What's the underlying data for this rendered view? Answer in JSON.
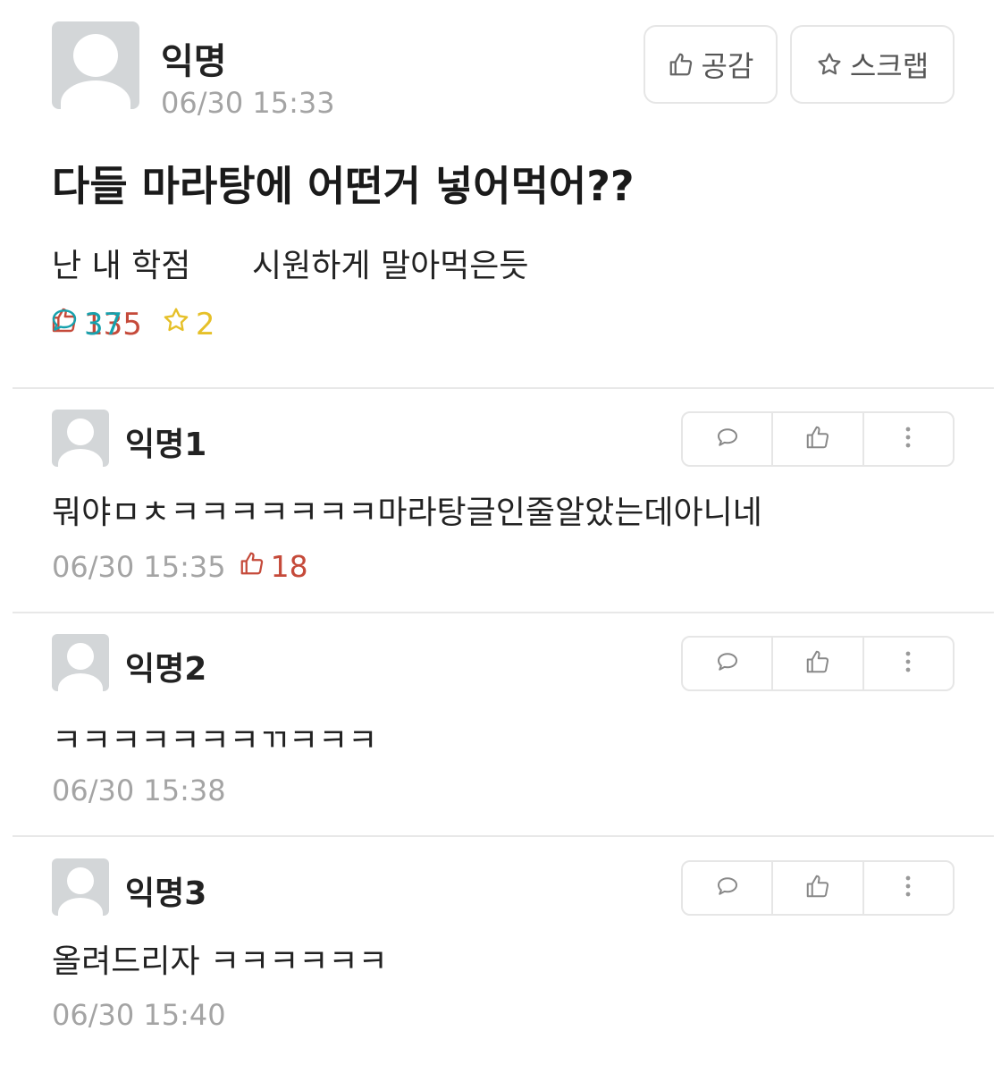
{
  "post": {
    "author": "익명",
    "time": "06/30 15:33",
    "empathy_label": "공감",
    "scrap_label": "스크랩",
    "title": "다들 마라탕에 어떤거 넣어먹어??",
    "body": "난 내 학점      시원하게 말아먹은듯",
    "likes": "135",
    "comments": "37",
    "scraps": "2"
  },
  "comments": [
    {
      "author": "익명1",
      "text": "뭐야ㅁㅊㅋㅋㅋㅋㅋㅋㅋ마라탕글인줄알았는데아니네",
      "time": "06/30 15:35",
      "likes": "18"
    },
    {
      "author": "익명2",
      "text": "ㅋㅋㅋㅋㅋㅋㅋㄲㅋㅋㅋ",
      "time": "06/30 15:38"
    },
    {
      "author": "익명3",
      "text": "올려드리자 ㅋㅋㅋㅋㅋㅋ",
      "time": "06/30 15:40"
    }
  ],
  "colors": {
    "like": "#c54a3a",
    "comment": "#16a1ad",
    "scrap": "#e6c028",
    "meta": "#a4a4a4"
  },
  "icons": {
    "like": "thumbs-up-icon",
    "comment": "speech-bubble-icon",
    "scrap": "star-icon",
    "more": "more-vertical-icon"
  }
}
